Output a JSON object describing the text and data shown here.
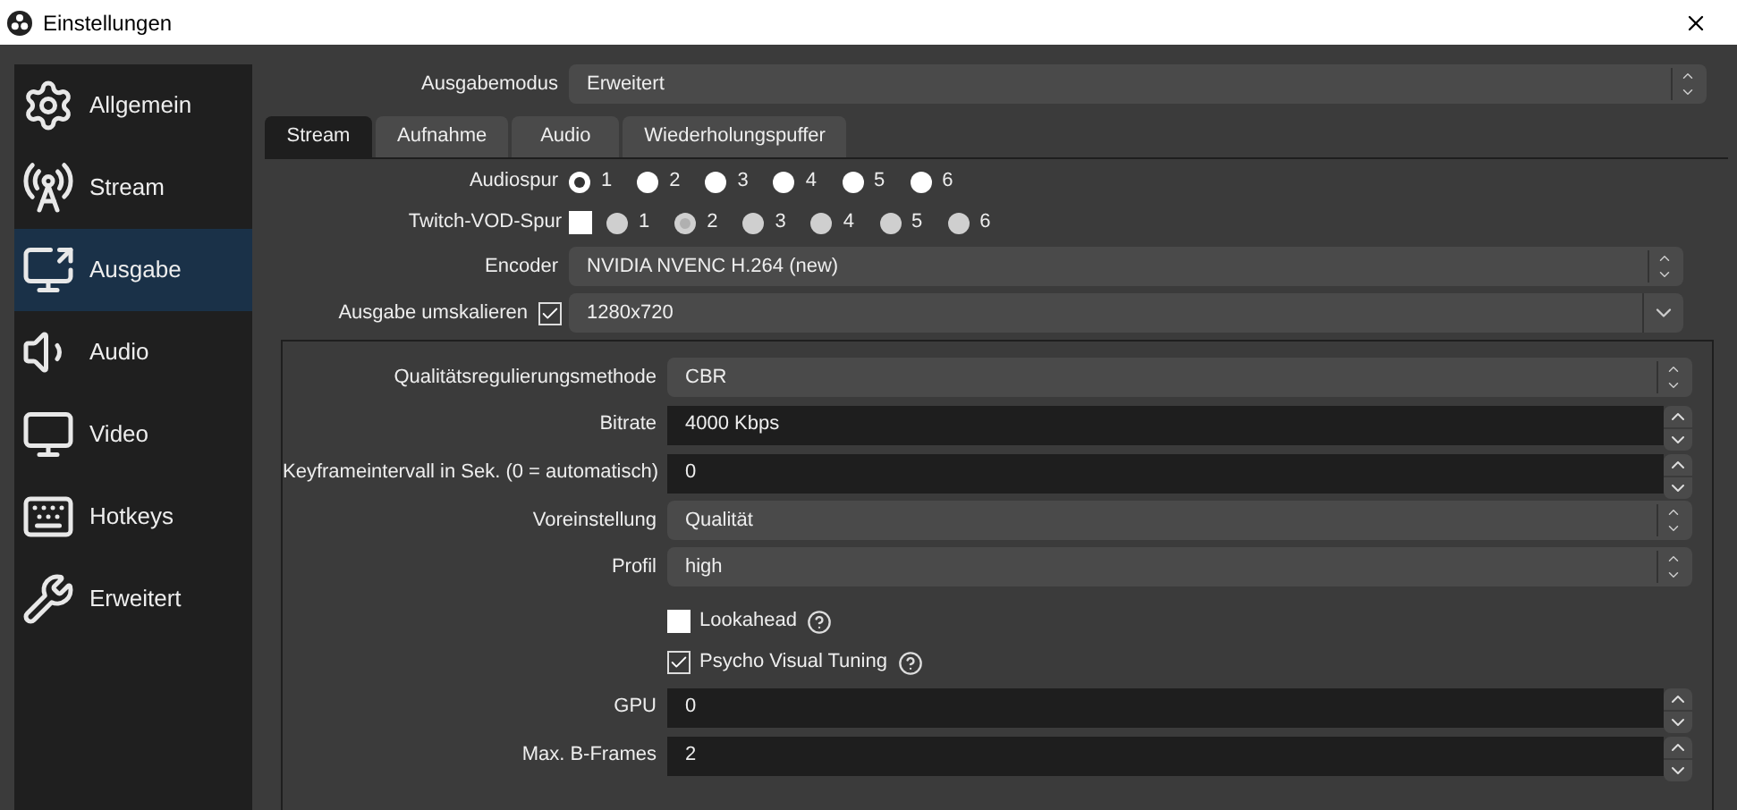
{
  "window": {
    "title": "Einstellungen"
  },
  "sidebar": {
    "items": [
      {
        "label": "Allgemein",
        "selected": false
      },
      {
        "label": "Stream",
        "selected": false
      },
      {
        "label": "Ausgabe",
        "selected": true
      },
      {
        "label": "Audio",
        "selected": false
      },
      {
        "label": "Video",
        "selected": false
      },
      {
        "label": "Hotkeys",
        "selected": false
      },
      {
        "label": "Erweitert",
        "selected": false
      }
    ]
  },
  "output_mode": {
    "label": "Ausgabemodus",
    "value": "Erweitert"
  },
  "tabs": [
    {
      "label": "Stream",
      "selected": true
    },
    {
      "label": "Aufnahme",
      "selected": false
    },
    {
      "label": "Audio",
      "selected": false
    },
    {
      "label": "Wiederholungspuffer",
      "selected": false
    }
  ],
  "audio_track": {
    "label": "Audiospur",
    "disabled": false,
    "options": [
      {
        "label": "1",
        "selected": true
      },
      {
        "label": "2",
        "selected": false
      },
      {
        "label": "3",
        "selected": false
      },
      {
        "label": "4",
        "selected": false
      },
      {
        "label": "5",
        "selected": false
      },
      {
        "label": "6",
        "selected": false
      }
    ]
  },
  "twitch_vod_track": {
    "label": "Twitch-VOD-Spur",
    "checked": false,
    "disabled": true,
    "options": [
      {
        "label": "1",
        "selected": false
      },
      {
        "label": "2",
        "selected": true
      },
      {
        "label": "3",
        "selected": false
      },
      {
        "label": "4",
        "selected": false
      },
      {
        "label": "5",
        "selected": false
      },
      {
        "label": "6",
        "selected": false
      }
    ]
  },
  "encoder": {
    "label": "Encoder",
    "value": "NVIDIA NVENC H.264 (new)"
  },
  "rescale": {
    "label": "Ausgabe umskalieren",
    "checked": true,
    "value": "1280x720"
  },
  "encoder_settings": [
    {
      "kind": "combo",
      "label": "Qualitätsregulierungsmethode",
      "value": "CBR"
    },
    {
      "kind": "spin",
      "label": "Bitrate",
      "value": "4000 Kbps"
    },
    {
      "kind": "spin",
      "label": "Keyframeintervall in Sek. (0 = automatisch)",
      "value": "0"
    },
    {
      "kind": "combo",
      "label": "Voreinstellung",
      "value": "Qualität"
    },
    {
      "kind": "combo",
      "label": "Profil",
      "value": "high"
    },
    {
      "kind": "checkbox",
      "label": "Lookahead",
      "checked": false,
      "help": true
    },
    {
      "kind": "checkbox",
      "label": "Psycho Visual Tuning",
      "checked": true,
      "help": true
    },
    {
      "kind": "spin",
      "label": "GPU",
      "value": "0"
    },
    {
      "kind": "spin",
      "label": "Max. B-Frames",
      "value": "2"
    }
  ]
}
